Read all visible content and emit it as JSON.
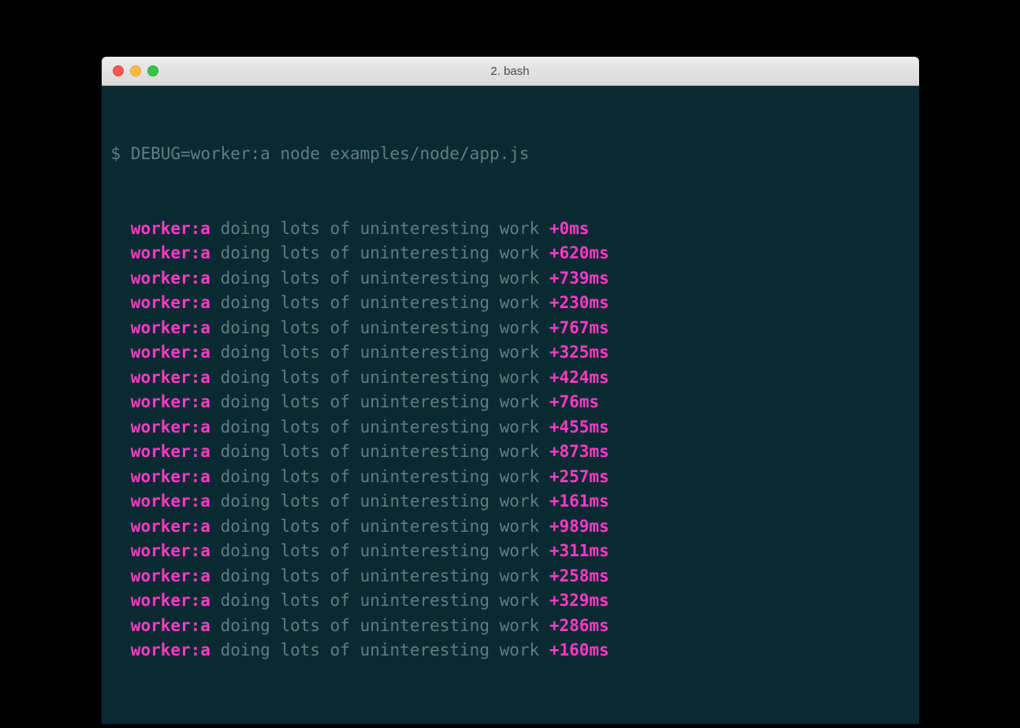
{
  "window": {
    "title": "2. bash"
  },
  "terminal": {
    "prompt_symbol": "$",
    "command": "DEBUG=worker:a node examples/node/app.js",
    "indent": "  ",
    "logs": [
      {
        "namespace": "worker:a",
        "message": "doing lots of uninteresting work",
        "timing": "+0ms"
      },
      {
        "namespace": "worker:a",
        "message": "doing lots of uninteresting work",
        "timing": "+620ms"
      },
      {
        "namespace": "worker:a",
        "message": "doing lots of uninteresting work",
        "timing": "+739ms"
      },
      {
        "namespace": "worker:a",
        "message": "doing lots of uninteresting work",
        "timing": "+230ms"
      },
      {
        "namespace": "worker:a",
        "message": "doing lots of uninteresting work",
        "timing": "+767ms"
      },
      {
        "namespace": "worker:a",
        "message": "doing lots of uninteresting work",
        "timing": "+325ms"
      },
      {
        "namespace": "worker:a",
        "message": "doing lots of uninteresting work",
        "timing": "+424ms"
      },
      {
        "namespace": "worker:a",
        "message": "doing lots of uninteresting work",
        "timing": "+76ms"
      },
      {
        "namespace": "worker:a",
        "message": "doing lots of uninteresting work",
        "timing": "+455ms"
      },
      {
        "namespace": "worker:a",
        "message": "doing lots of uninteresting work",
        "timing": "+873ms"
      },
      {
        "namespace": "worker:a",
        "message": "doing lots of uninteresting work",
        "timing": "+257ms"
      },
      {
        "namespace": "worker:a",
        "message": "doing lots of uninteresting work",
        "timing": "+161ms"
      },
      {
        "namespace": "worker:a",
        "message": "doing lots of uninteresting work",
        "timing": "+989ms"
      },
      {
        "namespace": "worker:a",
        "message": "doing lots of uninteresting work",
        "timing": "+311ms"
      },
      {
        "namespace": "worker:a",
        "message": "doing lots of uninteresting work",
        "timing": "+258ms"
      },
      {
        "namespace": "worker:a",
        "message": "doing lots of uninteresting work",
        "timing": "+329ms"
      },
      {
        "namespace": "worker:a",
        "message": "doing lots of uninteresting work",
        "timing": "+286ms"
      },
      {
        "namespace": "worker:a",
        "message": "doing lots of uninteresting work",
        "timing": "+160ms"
      }
    ]
  }
}
